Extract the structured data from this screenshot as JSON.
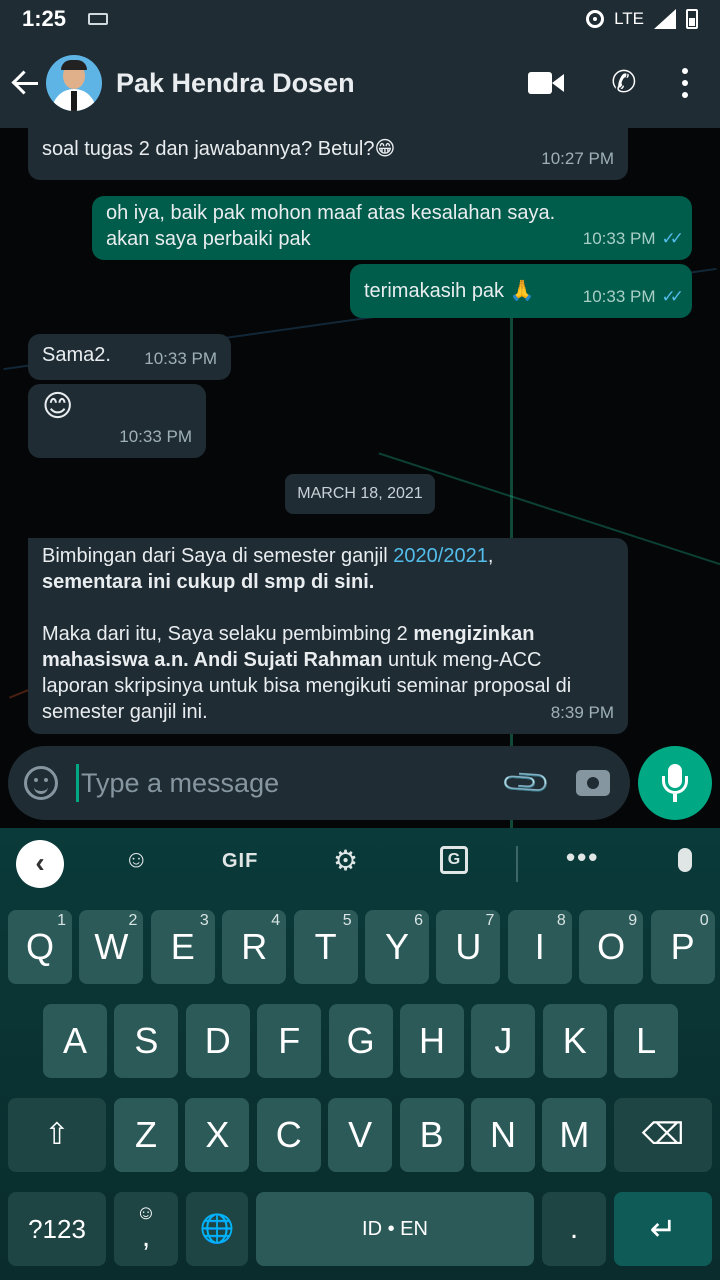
{
  "status_bar": {
    "time": "1:25",
    "network": "LTE"
  },
  "header": {
    "contact_name": "Pak Hendra Dosen"
  },
  "messages": [
    {
      "text": "soal tugas 2 dan jawabannya? Betul?😁",
      "time": "10:27 PM",
      "direction": "incoming"
    },
    {
      "text": "oh iya, baik pak mohon maaf atas kesalahan saya. akan saya perbaiki pak",
      "time": "10:33 PM",
      "direction": "outgoing",
      "ticks": "✓✓"
    },
    {
      "text": "terimakasih pak 🙏",
      "time": "10:33 PM",
      "direction": "outgoing",
      "ticks": "✓✓"
    },
    {
      "text": "Sama2.",
      "time": "10:33 PM",
      "direction": "incoming"
    },
    {
      "text": "😊",
      "time": "10:33 PM",
      "direction": "incoming"
    }
  ],
  "date_divider": "MARCH 18, 2021",
  "last_message": {
    "p1_a": "Bimbingan dari Saya di semester ganjil ",
    "p1_link": "2020/2021",
    "p1_b": ",",
    "p1_bold": "sementara ini cukup dl smp di sini.",
    "p2_a": "Maka dari itu, Saya selaku pembimbing 2 ",
    "p2_bold1": "mengizinkan mahasiswa a.n. Andi Sujati Rahman",
    "p2_b": " untuk meng-ACC laporan skripsinya untuk bisa mengikuti seminar proposal di semester ganjil ini.",
    "time": "8:39 PM"
  },
  "composer": {
    "placeholder": "Type a message"
  },
  "keyboard": {
    "toolbar": {
      "gif": "GIF"
    },
    "row1": [
      [
        "Q",
        "1"
      ],
      [
        "W",
        "2"
      ],
      [
        "E",
        "3"
      ],
      [
        "R",
        "4"
      ],
      [
        "T",
        "5"
      ],
      [
        "Y",
        "6"
      ],
      [
        "U",
        "7"
      ],
      [
        "I",
        "8"
      ],
      [
        "O",
        "9"
      ],
      [
        "P",
        "0"
      ]
    ],
    "row2": [
      "A",
      "S",
      "D",
      "F",
      "G",
      "H",
      "J",
      "K",
      "L"
    ],
    "row3": [
      "Z",
      "X",
      "C",
      "V",
      "B",
      "N",
      "M"
    ],
    "symbols": "?123",
    "comma": ",",
    "space": "ID • EN",
    "period": "."
  },
  "colors": {
    "header": "#1f2c34",
    "outgoing": "#005c4b",
    "accent": "#00a884",
    "ticks": "#53bdeb"
  }
}
